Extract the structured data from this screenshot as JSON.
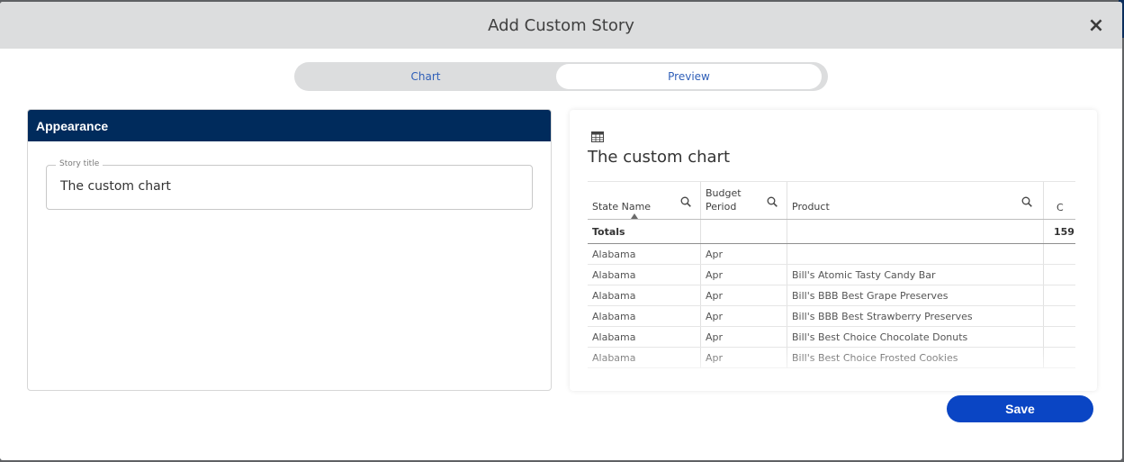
{
  "modal": {
    "title": "Add Custom Story",
    "close_label": "×"
  },
  "tabs": {
    "chart": "Chart",
    "preview": "Preview",
    "active": "Preview"
  },
  "appearance": {
    "header": "Appearance",
    "story_title_label": "Story title",
    "story_title_value": "The custom chart"
  },
  "preview": {
    "title": "The custom chart",
    "columns": [
      "State Name",
      "Budget Period",
      "Product",
      "C"
    ],
    "totals": {
      "label": "Totals",
      "value": "159"
    },
    "rows": [
      {
        "state": "Alabama",
        "period": "Apr",
        "product": ""
      },
      {
        "state": "Alabama",
        "period": "Apr",
        "product": "Bill's Atomic Tasty Candy Bar"
      },
      {
        "state": "Alabama",
        "period": "Apr",
        "product": "Bill's BBB Best Grape Preserves"
      },
      {
        "state": "Alabama",
        "period": "Apr",
        "product": "Bill's BBB Best Strawberry Preserves"
      },
      {
        "state": "Alabama",
        "period": "Apr",
        "product": "Bill's Best Choice Chocolate Donuts"
      },
      {
        "state": "Alabama",
        "period": "Apr",
        "product": "Bill's Best Choice Frosted Cookies"
      }
    ]
  },
  "actions": {
    "save": "Save"
  },
  "colors": {
    "accent": "#0a45c4",
    "panel_header": "#002b5c",
    "tab_text": "#2f5fb8"
  },
  "icons": {
    "close": "close-icon",
    "table": "table-icon",
    "search": "search-icon",
    "sort": "sort-ascending-icon"
  }
}
